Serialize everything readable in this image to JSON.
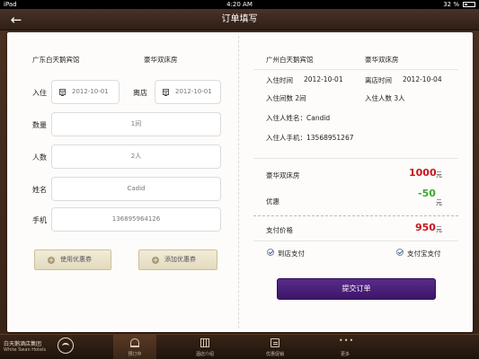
{
  "status": {
    "carrier": "iPad",
    "time": "4:20 AM",
    "battery": "32 %"
  },
  "nav": {
    "title": "订单填写"
  },
  "left": {
    "hotel": "广东白天鹅宾馆",
    "room": "豪华双床房",
    "checkin_label": "入住",
    "checkin_date": "2012-10-01",
    "checkout_label": "离店",
    "checkout_date": "2012-10-01",
    "qty_label": "数量",
    "qty_value": "1间",
    "people_label": "人数",
    "people_value": "2人",
    "name_label": "姓名",
    "name_value": "Cadid",
    "phone_label": "手机",
    "phone_value": "136895964126",
    "use_coupon": "使用优惠券",
    "add_coupon": "添加优惠券"
  },
  "right": {
    "hotel": "广州白天鹅宾馆",
    "room": "豪华双床房",
    "checkin_time_label": "入住时间",
    "checkin_time": "2012-10-01",
    "checkout_time_label": "离店时间",
    "checkout_time": "2012-10-04",
    "room_count": "入住间数 2间",
    "guest_count": "入住人数 3人",
    "guest_name": "入住人姓名：Candid",
    "guest_phone": "入住人手机：13568951267",
    "room_price_label": "豪华双床房",
    "room_price": "1000",
    "discount_label": "优惠",
    "discount": "-50",
    "total_label": "支付价格",
    "total": "950",
    "currency": "元",
    "pay_hotel": "到店支付",
    "pay_alipay": "支付宝支付",
    "submit": "提交订单"
  },
  "brand": {
    "cn": "白天鹅酒店集团",
    "en": "White Swan Hotels"
  },
  "tabs": [
    {
      "label": "预订中"
    },
    {
      "label": "酒店介绍"
    },
    {
      "label": "优惠促销"
    },
    {
      "label": "更多"
    }
  ]
}
